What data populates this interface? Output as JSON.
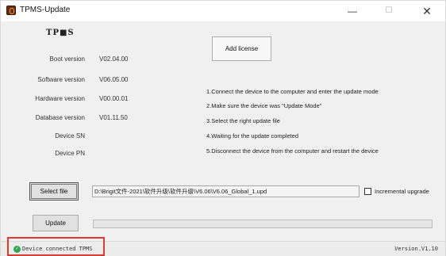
{
  "window": {
    "title": "TPMS-Update",
    "minimize": "—",
    "maximize": "☐",
    "close": "✕"
  },
  "logo": {
    "text": "TP■S"
  },
  "info": [
    {
      "label": "Boot   version",
      "value": "V02.04.00"
    },
    {
      "label": "Software version",
      "value": "V06.05.00"
    },
    {
      "label": "Hardware version",
      "value": "V00.00.01"
    },
    {
      "label": "Database version",
      "value": "V01.11.50"
    },
    {
      "label": "Device SN",
      "value": ""
    },
    {
      "label": "Device PN",
      "value": ""
    }
  ],
  "buttons": {
    "add_license": "Add license",
    "select_file": "Select file",
    "update": "Update"
  },
  "steps": [
    "1.Connect the device to the computer and enter the update mode",
    "2.Make sure the device was \"Update Mode\"",
    "3.Select the right update file",
    "4.Waiting for the update completed",
    "5.Disconnect the device from the computer and restart the device"
  ],
  "file": {
    "path": "D:\\Brigit文件-2021\\软件升级\\软件升级\\V6.06\\V6.06_Global_1.upd"
  },
  "incremental": {
    "label": "Incremental upgrade",
    "checked": false
  },
  "progress": {
    "value": 0
  },
  "status": {
    "text": "Device connected  TPMS",
    "version": "Version.V1.10",
    "ok_color": "#2fa84f",
    "highlight_color": "#e23a2e"
  }
}
